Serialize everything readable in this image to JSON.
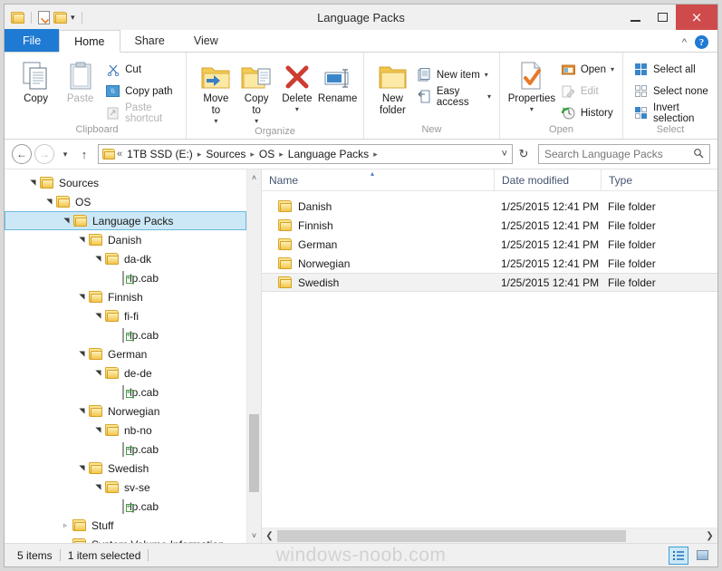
{
  "window": {
    "title": "Language Packs",
    "quick_access": [
      "folder-icon",
      "properties-icon",
      "new-folder-icon",
      "dropdown-caret"
    ],
    "controls": {
      "minimize": "minimize-icon",
      "maximize": "maximize-icon",
      "close": "×"
    }
  },
  "tabs": {
    "items": [
      {
        "label": "File",
        "kind": "file"
      },
      {
        "label": "Home",
        "kind": "active"
      },
      {
        "label": "Share",
        "kind": "normal"
      },
      {
        "label": "View",
        "kind": "normal"
      }
    ],
    "collapse_icon": "ⱏ",
    "help_label": "?"
  },
  "ribbon": {
    "groups": [
      {
        "label": "Clipboard",
        "big": [
          {
            "label": "Copy",
            "icon": "copy-icon",
            "enabled": true
          },
          {
            "label": "Paste",
            "icon": "paste-icon",
            "enabled": false
          }
        ],
        "small": [
          {
            "label": "Cut",
            "icon": "scissors-icon",
            "enabled": true
          },
          {
            "label": "Copy path",
            "icon": "copy-path-icon",
            "enabled": true
          },
          {
            "label": "Paste shortcut",
            "icon": "paste-shortcut-icon",
            "enabled": false
          }
        ]
      },
      {
        "label": "Organize",
        "big": [
          {
            "label": "Move\nto",
            "icon": "move-to-icon",
            "caret": true
          },
          {
            "label": "Copy\nto",
            "icon": "copy-to-icon",
            "caret": true
          },
          {
            "label": "Delete",
            "icon": "delete-icon",
            "caret": true
          },
          {
            "label": "Rename",
            "icon": "rename-icon",
            "caret": false
          }
        ]
      },
      {
        "label": "New",
        "big": [
          {
            "label": "New\nfolder",
            "icon": "new-folder-icon",
            "caret": false
          }
        ],
        "small": [
          {
            "label": "New item",
            "icon": "new-item-icon",
            "caret": true
          },
          {
            "label": "Easy access",
            "icon": "easy-access-icon",
            "caret": true
          }
        ]
      },
      {
        "label": "Open",
        "big": [
          {
            "label": "Properties",
            "icon": "properties-icon",
            "caret": true
          }
        ],
        "small": [
          {
            "label": "Open",
            "icon": "open-icon",
            "caret": true,
            "enabled": true
          },
          {
            "label": "Edit",
            "icon": "edit-icon",
            "caret": false,
            "enabled": false
          },
          {
            "label": "History",
            "icon": "history-icon",
            "caret": false,
            "enabled": true
          }
        ]
      },
      {
        "label": "Select",
        "small": [
          {
            "label": "Select all",
            "icon": "select-all-icon"
          },
          {
            "label": "Select none",
            "icon": "select-none-icon"
          },
          {
            "label": "Invert selection",
            "icon": "invert-selection-icon"
          }
        ]
      }
    ]
  },
  "address": {
    "back_icon": "←",
    "forward_icon": "→",
    "recent_icon": "▾",
    "up_icon": "↑",
    "overflow": "«",
    "crumbs": [
      "1TB SSD (E:)",
      "Sources",
      "OS",
      "Language Packs"
    ],
    "separator": "▸",
    "dropdown_icon": "˅",
    "refresh_icon": "↻",
    "search_placeholder": "Search Language Packs",
    "search_value": "",
    "search_icon": "search-icon"
  },
  "tree": {
    "nodes": [
      {
        "label": "Sources",
        "indent": 1,
        "twist": "open",
        "icon": "folder",
        "selected": false
      },
      {
        "label": "OS",
        "indent": 2,
        "twist": "open",
        "icon": "folder",
        "selected": false
      },
      {
        "label": "Language Packs",
        "indent": 3,
        "twist": "open",
        "icon": "folder",
        "selected": true
      },
      {
        "label": "Danish",
        "indent": 4,
        "twist": "open",
        "icon": "folder",
        "selected": false
      },
      {
        "label": "da-dk",
        "indent": 5,
        "twist": "open",
        "icon": "folder",
        "selected": false
      },
      {
        "label": "lp.cab",
        "indent": 6,
        "twist": "none",
        "icon": "cab",
        "selected": false
      },
      {
        "label": "Finnish",
        "indent": 4,
        "twist": "open",
        "icon": "folder",
        "selected": false
      },
      {
        "label": "fi-fi",
        "indent": 5,
        "twist": "open",
        "icon": "folder",
        "selected": false
      },
      {
        "label": "lp.cab",
        "indent": 6,
        "twist": "none",
        "icon": "cab",
        "selected": false
      },
      {
        "label": "German",
        "indent": 4,
        "twist": "open",
        "icon": "folder",
        "selected": false
      },
      {
        "label": "de-de",
        "indent": 5,
        "twist": "open",
        "icon": "folder",
        "selected": false
      },
      {
        "label": "lp.cab",
        "indent": 6,
        "twist": "none",
        "icon": "cab",
        "selected": false
      },
      {
        "label": "Norwegian",
        "indent": 4,
        "twist": "open",
        "icon": "folder",
        "selected": false
      },
      {
        "label": "nb-no",
        "indent": 5,
        "twist": "open",
        "icon": "folder",
        "selected": false
      },
      {
        "label": "lp.cab",
        "indent": 6,
        "twist": "none",
        "icon": "cab",
        "selected": false
      },
      {
        "label": "Swedish",
        "indent": 4,
        "twist": "open",
        "icon": "folder",
        "selected": false
      },
      {
        "label": "sv-se",
        "indent": 5,
        "twist": "open",
        "icon": "folder",
        "selected": false
      },
      {
        "label": "lp.cab",
        "indent": 6,
        "twist": "none",
        "icon": "cab",
        "selected": false
      },
      {
        "label": "Stuff",
        "indent": 3,
        "twist": "closed",
        "icon": "folder",
        "selected": false
      },
      {
        "label": "System Volume Information",
        "indent": 3,
        "twist": "none",
        "icon": "folder",
        "selected": false
      }
    ],
    "scroll_up_icon": "˄",
    "scroll_down_icon": "˅"
  },
  "filelist": {
    "columns": [
      {
        "label": "Name",
        "sorted": true,
        "sort_icon": "▴"
      },
      {
        "label": "Date modified",
        "sorted": false
      },
      {
        "label": "Type",
        "sorted": false
      }
    ],
    "rows": [
      {
        "name": "Danish",
        "date": "1/25/2015 12:41 PM",
        "type": "File folder",
        "selected": false
      },
      {
        "name": "Finnish",
        "date": "1/25/2015 12:41 PM",
        "type": "File folder",
        "selected": false
      },
      {
        "name": "German",
        "date": "1/25/2015 12:41 PM",
        "type": "File folder",
        "selected": false
      },
      {
        "name": "Norwegian",
        "date": "1/25/2015 12:41 PM",
        "type": "File folder",
        "selected": false
      },
      {
        "name": "Swedish",
        "date": "1/25/2015 12:41 PM",
        "type": "File folder",
        "selected": true
      }
    ],
    "hscroll_left_icon": "❮",
    "hscroll_right_icon": "❯"
  },
  "status": {
    "item_count": "5 items",
    "selection": "1 item selected",
    "watermark": "windows-noob.com",
    "views": [
      {
        "name": "details-view",
        "active": true
      },
      {
        "name": "large-icons-view",
        "active": false
      }
    ]
  },
  "colors": {
    "accent": "#1f7ad3",
    "close_button": "#cf4b4b",
    "selection": "#cce8f6",
    "selection_border": "#6cb9dd",
    "folder_yellow": "#f5c84f",
    "column_header_text": "#44546f"
  }
}
